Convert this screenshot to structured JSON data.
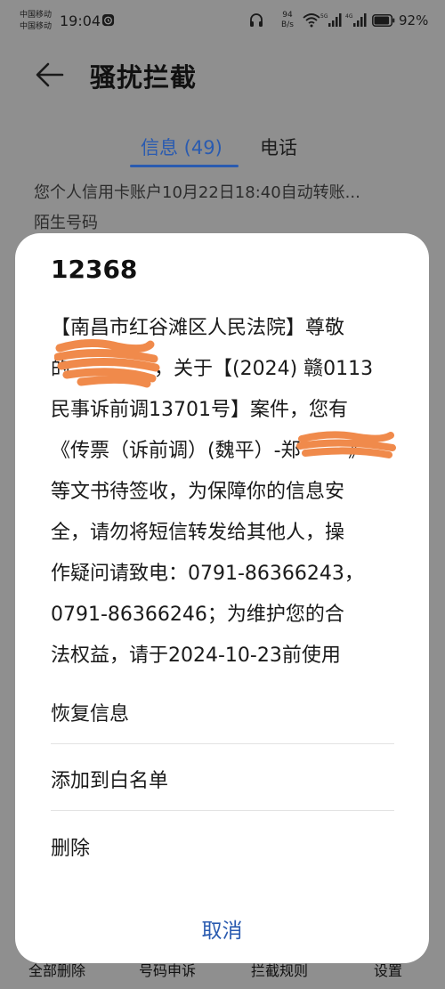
{
  "status_bar": {
    "carrier_1": "中国移动",
    "carrier_2": "中国移动",
    "time": "19:04",
    "net_speed_value": "94",
    "net_speed_unit": "B/s",
    "signal_1_label": "5G",
    "signal_2_label": "4G",
    "battery": "92%",
    "battery_level": 0.92
  },
  "header": {
    "title": "骚扰拦截"
  },
  "tabs": [
    {
      "label": "信息 (49)",
      "active": true
    },
    {
      "label": "电话",
      "active": false
    }
  ],
  "list_preview": {
    "text": "您个人信用卡账户10月22日18:40自动转账...",
    "subtitle": "陌生号码"
  },
  "toolbar": {
    "items": [
      "全部删除",
      "号码申诉",
      "拦截规则",
      "设置"
    ]
  },
  "dialog": {
    "sender": "12368",
    "message_lines": [
      "【南昌市红谷滩区人民法院】尊敬",
      "的",
      "，关于【(2024) 赣0113",
      "民事诉前调13701号】案件，您有",
      "《传票（诉前调）(魏平）-郑",
      "》",
      "等文书待签收，为保障你的信息安",
      "全，请勿将短信转发给其他人，操",
      "作疑问请致电：0791-86366243，",
      "0791-86366246；为维护您的合",
      "法权益，请于2024-10-23前使用"
    ],
    "actions": [
      "恢复信息",
      "添加到白名单",
      "删除"
    ],
    "cancel": "取消"
  },
  "colors": {
    "accent": "#2a5bb0",
    "scrim": "#8f8f8f",
    "redaction": "#f08a4b"
  }
}
